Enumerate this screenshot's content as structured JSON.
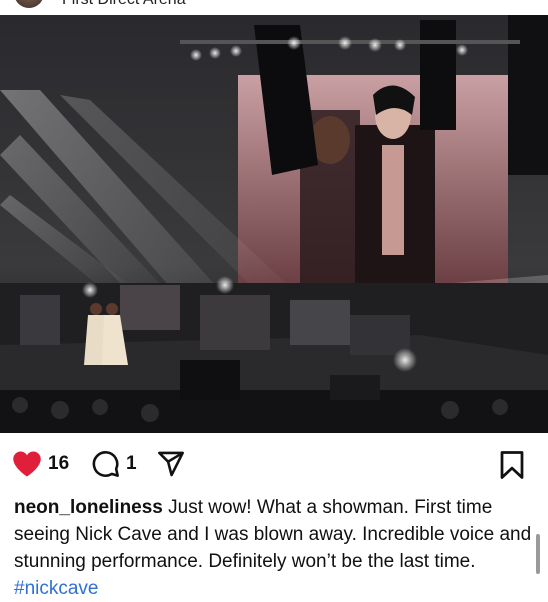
{
  "post": {
    "location": "First Direct Arena",
    "likes": "16",
    "comments": "1",
    "username": "neon_loneliness",
    "caption_text": " Just wow! What a showman. First time seeing Nick Cave and I was blown away. Incredible voice and stunning performance. Definitely won’t be the last time. ",
    "hashtag": "#nickcave"
  },
  "icons": {
    "like": "heart-filled-icon",
    "comment": "speech-bubble-icon",
    "share": "paper-plane-icon",
    "save": "bookmark-icon"
  },
  "colors": {
    "like": "#e0203a",
    "hashtag": "#2f6fd6"
  }
}
